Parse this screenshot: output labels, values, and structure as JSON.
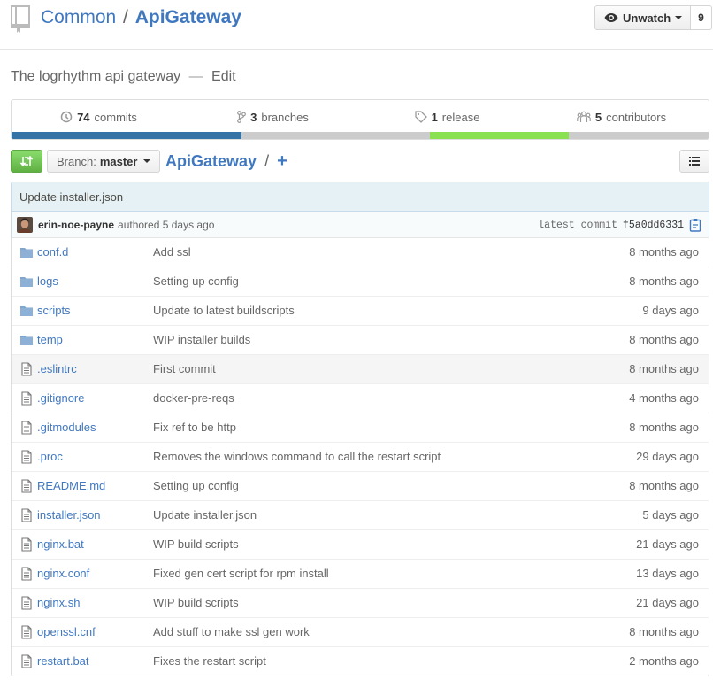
{
  "repo": {
    "owner": "Common",
    "separator": "/",
    "name": "ApiGateway",
    "watch_label": "Unwatch",
    "watch_count": "9",
    "description": "The logrhythm api gateway",
    "desc_dash": "—",
    "edit_label": "Edit"
  },
  "summary": {
    "commits": {
      "count": "74",
      "label": "commits"
    },
    "branches": {
      "count": "3",
      "label": "branches"
    },
    "releases": {
      "count": "1",
      "label": "release"
    },
    "contributors": {
      "count": "5",
      "label": "contributors"
    }
  },
  "language_bar": {
    "segments": [
      {
        "color": "#3572a5",
        "fraction": 0.33
      },
      {
        "color": "#cccccc",
        "fraction": 0.27
      },
      {
        "color": "#89e051",
        "fraction": 0.2
      },
      {
        "color": "#cccccc",
        "fraction": 0.2
      }
    ]
  },
  "nav": {
    "branch_label": "Branch:",
    "branch_value": "master",
    "breadcrumb_root": "ApiGateway",
    "breadcrumb_slash": "/",
    "new_file": "+"
  },
  "commit": {
    "message": "Update installer.json",
    "author": "erin-noe-payne",
    "action": "authored 5 days ago",
    "latest_label": "latest commit",
    "sha": "f5a0dd6331"
  },
  "files": [
    {
      "type": "dir",
      "icon": "folder-icon",
      "name": "conf.d",
      "message": "Add ssl",
      "age": "8 months ago"
    },
    {
      "type": "dir",
      "icon": "folder-icon",
      "name": "logs",
      "message": "Setting up config",
      "age": "8 months ago"
    },
    {
      "type": "dir",
      "icon": "folder-icon",
      "name": "scripts",
      "message": "Update to latest buildscripts",
      "age": "9 days ago"
    },
    {
      "type": "dir",
      "icon": "folder-icon",
      "name": "temp",
      "message": "WIP installer builds",
      "age": "8 months ago"
    },
    {
      "type": "file",
      "icon": "file-icon",
      "name": ".eslintrc",
      "message": "First commit",
      "age": "8 months ago"
    },
    {
      "type": "file",
      "icon": "file-icon",
      "name": ".gitignore",
      "message": "docker-pre-reqs",
      "age": "4 months ago"
    },
    {
      "type": "file",
      "icon": "file-icon",
      "name": ".gitmodules",
      "message": "Fix ref to be http",
      "age": "8 months ago"
    },
    {
      "type": "file",
      "icon": "file-icon",
      "name": ".proc",
      "message": "Removes the windows command to call the restart script",
      "age": "29 days ago"
    },
    {
      "type": "file",
      "icon": "file-icon",
      "name": "README.md",
      "message": "Setting up config",
      "age": "8 months ago"
    },
    {
      "type": "file",
      "icon": "file-icon",
      "name": "installer.json",
      "message": "Update installer.json",
      "age": "5 days ago"
    },
    {
      "type": "file",
      "icon": "file-icon",
      "name": "nginx.bat",
      "message": "WIP build scripts",
      "age": "21 days ago"
    },
    {
      "type": "file",
      "icon": "file-icon",
      "name": "nginx.conf",
      "message": "Fixed gen cert script for rpm install",
      "age": "13 days ago"
    },
    {
      "type": "file",
      "icon": "file-icon",
      "name": "nginx.sh",
      "message": "WIP build scripts",
      "age": "21 days ago"
    },
    {
      "type": "file",
      "icon": "file-icon",
      "name": "openssl.cnf",
      "message": "Add stuff to make ssl gen work",
      "age": "8 months ago"
    },
    {
      "type": "file",
      "icon": "file-icon",
      "name": "restart.bat",
      "message": "Fixes the restart script",
      "age": "2 months ago"
    }
  ],
  "colors": {
    "link": "#4078c0",
    "compare_green": "#60b044",
    "commit_bg": "#e6f1f6"
  }
}
